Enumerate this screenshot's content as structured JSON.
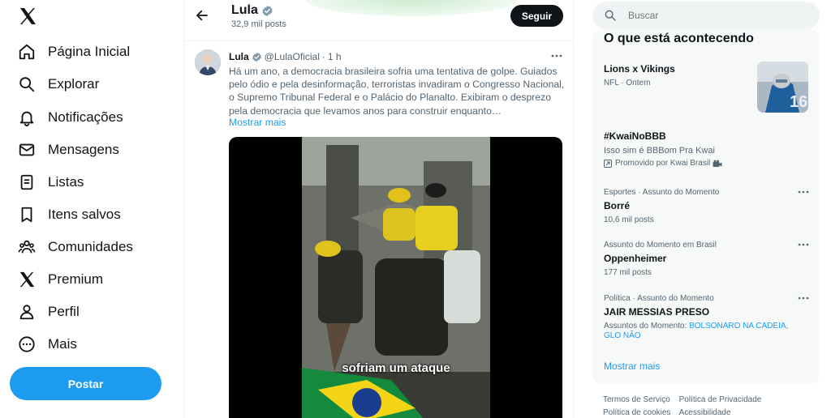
{
  "nav": {
    "items": [
      {
        "label": "Página Inicial",
        "icon": "home-icon"
      },
      {
        "label": "Explorar",
        "icon": "search-icon"
      },
      {
        "label": "Notificações",
        "icon": "bell-icon"
      },
      {
        "label": "Mensagens",
        "icon": "envelope-icon"
      },
      {
        "label": "Listas",
        "icon": "list-icon"
      },
      {
        "label": "Itens salvos",
        "icon": "bookmark-icon"
      },
      {
        "label": "Comunidades",
        "icon": "people-icon"
      },
      {
        "label": "Premium",
        "icon": "x-logo-icon"
      },
      {
        "label": "Perfil",
        "icon": "person-icon"
      },
      {
        "label": "Mais",
        "icon": "more-circle-icon"
      }
    ],
    "post_button": "Postar"
  },
  "header": {
    "name": "Lula",
    "posts_count": "32,9 mil posts",
    "follow_button": "Seguir"
  },
  "tweet": {
    "author": "Lula",
    "handle": "@LulaOficial",
    "dot": "·",
    "time": "1 h",
    "text": "Há um ano, a democracia brasileira sofria uma tentativa de golpe. Guiados pelo ódio e pela desinformação, terroristas invadiram o Congresso Nacional, o Supremo Tribunal Federal e o Palácio do Planalto.  Exibiram o desprezo pela democracia que levamos anos para construir enquanto…",
    "show_more": "Mostrar mais",
    "video_caption": "sofriam um ataque"
  },
  "search": {
    "placeholder": "Buscar"
  },
  "trends": {
    "title": "O que está acontecendo",
    "items": [
      {
        "name": "Lions x Vikings",
        "meta": "NFL · Ontem"
      },
      {
        "name": "#KwaiNoBBB",
        "sub": "Isso sim é BBBom Pra Kwai",
        "promo": "Promovido por Kwai Brasil"
      },
      {
        "meta": "Esportes · Assunto do Momento",
        "name": "Borré",
        "count": "10,6 mil posts"
      },
      {
        "meta": "Assunto do Momento em Brasil",
        "name": "Oppenheimer",
        "count": "177 mil posts"
      },
      {
        "meta": "Política · Assunto do Momento",
        "name": "JAIR MESSIAS PRESO",
        "related_prefix": "Assuntos do Momento:",
        "related_1": "BOLSONARO NA CADEIA,",
        "related_2": "GLO NÃO"
      }
    ],
    "show_more": "Mostrar mais"
  },
  "footer": {
    "links_row1": [
      "Termos de Serviço",
      "Política de Privacidade"
    ],
    "links_row2": [
      "Política de cookies",
      "Acessibilidade"
    ]
  },
  "colors": {
    "accent": "#1d9bf0",
    "text_primary": "#0f1419",
    "text_secondary": "#536471"
  }
}
